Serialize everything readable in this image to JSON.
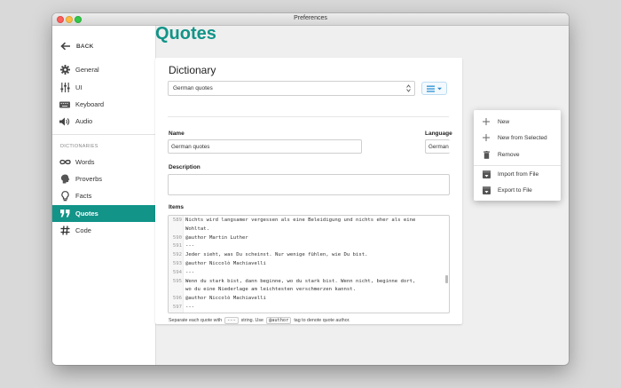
{
  "window": {
    "title": "Preferences"
  },
  "sidebar": {
    "back_label": "BACK",
    "items": [
      {
        "label": "General",
        "icon": "gear-icon"
      },
      {
        "label": "UI",
        "icon": "sliders-icon"
      },
      {
        "label": "Keyboard",
        "icon": "keyboard-icon"
      },
      {
        "label": "Audio",
        "icon": "speaker-icon"
      }
    ],
    "section_label": "DICTIONARIES",
    "dictionaries": [
      {
        "label": "Words",
        "icon": "infinity-icon"
      },
      {
        "label": "Proverbs",
        "icon": "brain-icon"
      },
      {
        "label": "Facts",
        "icon": "lightbulb-icon"
      },
      {
        "label": "Quotes",
        "icon": "quote-icon",
        "active": true
      },
      {
        "label": "Code",
        "icon": "hash-icon"
      }
    ]
  },
  "main": {
    "page_title": "Quotes",
    "card_title": "Dictionary",
    "selected_dictionary": "German quotes",
    "name_label": "Name",
    "name_value": "German quotes",
    "language_label": "Language",
    "language_value": "German",
    "description_label": "Description",
    "description_value": "",
    "items_label": "Items",
    "editor_lines": [
      {
        "n": "589",
        "t": "Nichts wird langsamer vergessen als eine Beleidigung und nichts eher als eine"
      },
      {
        "n": "",
        "t": "Wohltat."
      },
      {
        "n": "590",
        "t": "@author Martin Luther"
      },
      {
        "n": "591",
        "t": "---"
      },
      {
        "n": "592",
        "t": "Jeder sieht, was Du scheinst. Nur wenige fühlen, wie Du bist."
      },
      {
        "n": "593",
        "t": "@author Niccolò Machiavelli"
      },
      {
        "n": "594",
        "t": "---"
      },
      {
        "n": "595",
        "t": "Wenn du stark bist, dann beginne, wo du stark bist. Wenn nicht, beginne dort,"
      },
      {
        "n": "",
        "t": "wo du eine Niederlage am leichtesten verschmerzen kannst."
      },
      {
        "n": "596",
        "t": "@author Niccolò Machiavelli"
      },
      {
        "n": "597",
        "t": "---"
      }
    ],
    "hint": {
      "part1": "Separate each quote with",
      "code1": "---",
      "part2": "string. Use",
      "code2": "@author",
      "part3": "tag to denote quote author."
    }
  },
  "dropdown": {
    "new": "New",
    "new_from_selected": "New from Selected",
    "remove": "Remove",
    "import": "Import from File",
    "export": "Export to File"
  },
  "colors": {
    "accent": "#129488",
    "menu_icon": "#2a8fd4"
  }
}
